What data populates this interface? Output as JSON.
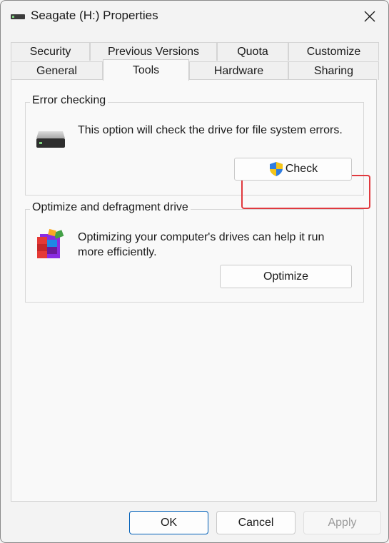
{
  "window": {
    "title": "Seagate (H:) Properties"
  },
  "tabs": {
    "row1": [
      "Security",
      "Previous Versions",
      "Quota",
      "Customize"
    ],
    "row2": [
      "General",
      "Tools",
      "Hardware",
      "Sharing"
    ],
    "active": "Tools"
  },
  "error_checking": {
    "title": "Error checking",
    "description": "This option will check the drive for file system errors.",
    "button_label": "Check"
  },
  "optimize": {
    "title": "Optimize and defragment drive",
    "description": "Optimizing your computer's drives can help it run more efficiently.",
    "button_label": "Optimize"
  },
  "footer": {
    "ok": "OK",
    "cancel": "Cancel",
    "apply": "Apply"
  }
}
